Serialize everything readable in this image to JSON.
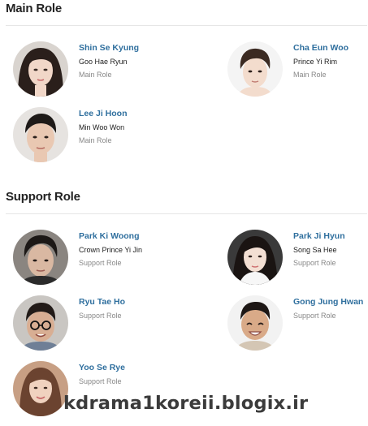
{
  "main_section": {
    "title": "Main Role",
    "cast": [
      {
        "actor": "Shin Se Kyung",
        "character": "Goo Hae Ryun",
        "role": "Main Role",
        "avatar_icon": "actress-portrait"
      },
      {
        "actor": "Cha Eun Woo",
        "character": "Prince Yi Rim",
        "role": "Main Role",
        "avatar_icon": "actor-portrait"
      },
      {
        "actor": "Lee Ji Hoon",
        "character": "Min Woo Won",
        "role": "Main Role",
        "avatar_icon": "actor-portrait"
      }
    ]
  },
  "support_section": {
    "title": "Support Role",
    "cast": [
      {
        "actor": "Park Ki Woong",
        "character": "Crown Prince Yi Jin",
        "role": "Support Role",
        "avatar_icon": "actor-portrait"
      },
      {
        "actor": "Park Ji Hyun",
        "character": "Song Sa Hee",
        "role": "Support Role",
        "avatar_icon": "actress-portrait"
      },
      {
        "actor": "Ryu Tae Ho",
        "role": "Support Role",
        "avatar_icon": "actor-portrait"
      },
      {
        "actor": "Gong Jung Hwan",
        "role": "Support Role",
        "avatar_icon": "actor-portrait"
      },
      {
        "actor": "Yoo Se Rye",
        "role": "Support Role",
        "avatar_icon": "actress-portrait"
      }
    ]
  },
  "watermark": "kdrama1koreii.blogix.ir",
  "colors": {
    "actor_link": "#2f6f9e",
    "section_title": "#222222",
    "secondary_text": "#888888",
    "divider": "#e6e6e6"
  }
}
